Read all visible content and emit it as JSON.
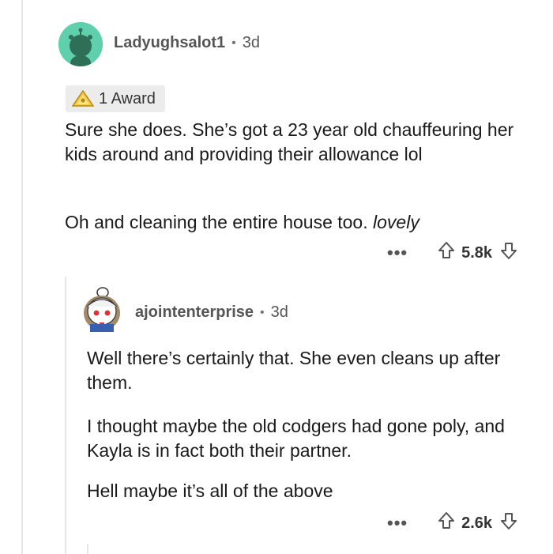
{
  "comments": [
    {
      "author": "Ladyughsalot1",
      "separator": "•",
      "age": "3d",
      "award": "1 Award",
      "paragraphs": [
        "Sure she does. She’s got a 23 year old chauffeuring her kids around and providing their allowance lol",
        "Oh and cleaning the entire house too."
      ],
      "paragraph_italic_tail": "lovely",
      "more": "•••",
      "score": "5.8k"
    },
    {
      "author": "ajointenterprise",
      "separator": "•",
      "age": "3d",
      "paragraphs": [
        "Well there’s certainly that. She even cleans up after them.",
        "I thought maybe the old codgers had gone poly, and Kayla is in fact both their partner.",
        "Hell maybe it’s all of the above"
      ],
      "more": "•••",
      "score": "2.6k"
    }
  ],
  "icons": {
    "avatar1": "reddit-snoo-avatar-icon",
    "avatar2": "anime-snoo-avatar-icon",
    "award": "award-triangle-icon",
    "upvote": "upvote-arrow-icon",
    "downvote": "downvote-arrow-icon"
  },
  "colors": {
    "avatar1_bg": "#5fd0ab",
    "thread_line": "#e6e6e6"
  }
}
